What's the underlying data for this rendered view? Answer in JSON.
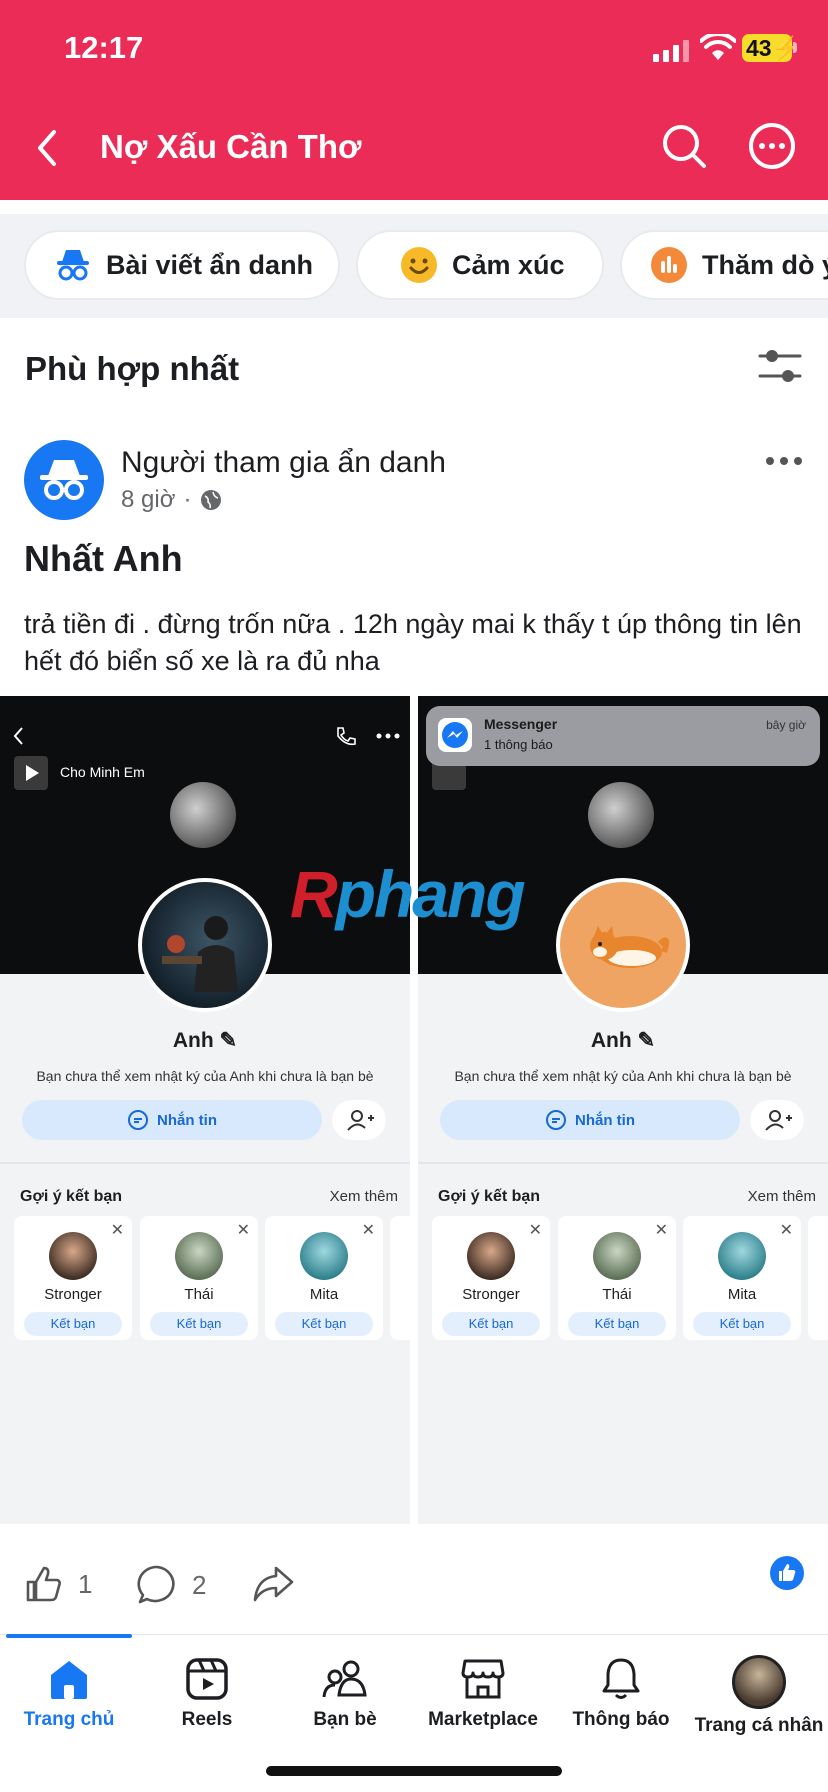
{
  "status_bar": {
    "time": "12:17",
    "battery": "43"
  },
  "header": {
    "title": "Nợ Xấu Cần Thơ",
    "bg_color": "#ea2c56"
  },
  "chips": [
    {
      "label": "Bài viết ẩn danh",
      "icon": "incognito-icon"
    },
    {
      "label": "Cảm xúc",
      "icon": "smiley-icon"
    },
    {
      "label": "Thăm dò ý",
      "icon": "poll-icon"
    }
  ],
  "section": {
    "title": "Phù hợp nhất"
  },
  "post": {
    "author": "Người tham gia ẩn danh",
    "time": "8 giờ",
    "separator": "·",
    "title": "Nhất Anh",
    "body": "trả tiền đi .  đừng trốn nữa . 12h ngày mai k thấy t úp thông tin lên hết đó biển số xe là ra đủ nha",
    "likes": "1",
    "comments": "2"
  },
  "screenshot": {
    "music": "Cho Minh Em",
    "name": "Anh",
    "note": "Bạn chưa thể xem nhật ký của Anh khi chưa là bạn bè",
    "message_btn": "Nhắn tin",
    "suggest_title": "Gợi ý kết bạn",
    "see_more": "Xem thêm",
    "friends": [
      {
        "name": "Stronger",
        "btn": "Kết bạn"
      },
      {
        "name": "Thái",
        "btn": "Kết bạn"
      },
      {
        "name": "Mita",
        "btn": "Kết bạn"
      }
    ],
    "notification": {
      "app": "Messenger",
      "text": "1 thông báo",
      "time": "bây giờ"
    },
    "watermark_a": "R",
    "watermark_b": "phang"
  },
  "nav": [
    {
      "label": "Trang chủ",
      "icon": "home-icon",
      "active": true
    },
    {
      "label": "Reels",
      "icon": "reels-icon"
    },
    {
      "label": "Bạn bè",
      "icon": "friends-icon"
    },
    {
      "label": "Marketplace",
      "icon": "marketplace-icon"
    },
    {
      "label": "Thông báo",
      "icon": "bell-icon"
    },
    {
      "label": "Trang cá nhân",
      "icon": "profile-avatar"
    }
  ]
}
